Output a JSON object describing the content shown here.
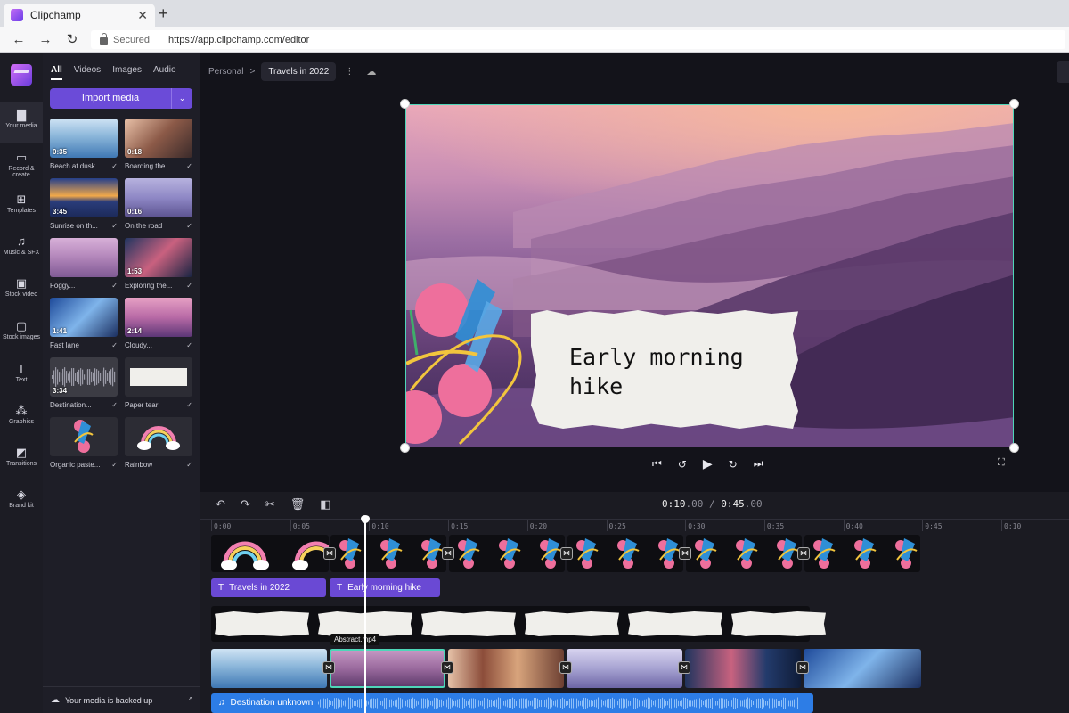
{
  "browser": {
    "tab_title": "Clipchamp",
    "tab_close": "✕",
    "new_tab": "+",
    "nav": {
      "back": "←",
      "forward": "→",
      "reload": "↻"
    },
    "secured": "Secured",
    "url": "https://app.clipchamp.com/editor"
  },
  "rail": {
    "items": [
      {
        "label": "Your media",
        "icon": "folder-icon",
        "glyph": "▇"
      },
      {
        "label": "Record & create",
        "icon": "camera-icon",
        "glyph": "▭"
      },
      {
        "label": "Templates",
        "icon": "templates-icon",
        "glyph": "⊞"
      },
      {
        "label": "Music & SFX",
        "icon": "music-icon",
        "glyph": "♫"
      },
      {
        "label": "Stock video",
        "icon": "film-icon",
        "glyph": "▣"
      },
      {
        "label": "Stock images",
        "icon": "image-icon",
        "glyph": "▢"
      },
      {
        "label": "Text",
        "icon": "text-icon",
        "glyph": "T"
      },
      {
        "label": "Graphics",
        "icon": "shapes-icon",
        "glyph": "⁂"
      },
      {
        "label": "Transitions",
        "icon": "transitions-icon",
        "glyph": "◩"
      },
      {
        "label": "Brand kit",
        "icon": "brand-kit-icon",
        "glyph": "◈"
      }
    ]
  },
  "media": {
    "filters": [
      "All",
      "Videos",
      "Images",
      "Audio"
    ],
    "import_label": "Import media",
    "import_arrow": "⌄",
    "items": [
      {
        "name": "Beach at dusk",
        "duration": "0:35"
      },
      {
        "name": "Boarding the...",
        "duration": "0:18"
      },
      {
        "name": "Sunrise on th...",
        "duration": "3:45"
      },
      {
        "name": "On the road",
        "duration": "0:16"
      },
      {
        "name": "Foggy...",
        "duration": ""
      },
      {
        "name": "Exploring the...",
        "duration": "1:53"
      },
      {
        "name": "Fast lane",
        "duration": "1:41"
      },
      {
        "name": "Cloudy...",
        "duration": "2:14"
      },
      {
        "name": "Destination...",
        "duration": "3:34"
      },
      {
        "name": "Paper tear",
        "duration": ""
      },
      {
        "name": "Organic paste...",
        "duration": ""
      },
      {
        "name": "Rainbow",
        "duration": ""
      }
    ],
    "checkmark": "✓",
    "backup_label": "Your media is backed up",
    "backup_caret": "^",
    "collapse_glyph": "‹"
  },
  "editor": {
    "breadcrumb_root": "Personal",
    "breadcrumb_sep": ">",
    "project_name": "Travels in 2022",
    "more": "⋮",
    "cloud_glyph": "☁",
    "overlay_text_line1": "Early morning",
    "overlay_text_line2": "hike",
    "controls": {
      "skip_back": "⏮",
      "rewind": "↺",
      "play": "▶",
      "forward": "↻",
      "skip_fwd": "⏭"
    },
    "fullscreen": "⛶"
  },
  "timeline": {
    "tools": {
      "undo": "↶",
      "redo": "↷",
      "cut": "✂",
      "delete": "🗑",
      "audio": "◧"
    },
    "current_time": "0:10",
    "current_frac": ".00",
    "time_sep": " / ",
    "total_time": "0:45",
    "total_frac": ".00",
    "ticks": [
      "0:00",
      "0:05",
      "0:10",
      "0:15",
      "0:20",
      "0:25",
      "0:30",
      "0:35",
      "0:40",
      "0:45",
      "0:10"
    ],
    "text_clips": [
      "Travels in 2022",
      "Early morning hike"
    ],
    "text_glyph": "T",
    "tooltip": "Abstract.mp4",
    "audio_clip": "Destination unknown",
    "audio_glyph": "♫",
    "transition_glyph": "⋈"
  }
}
